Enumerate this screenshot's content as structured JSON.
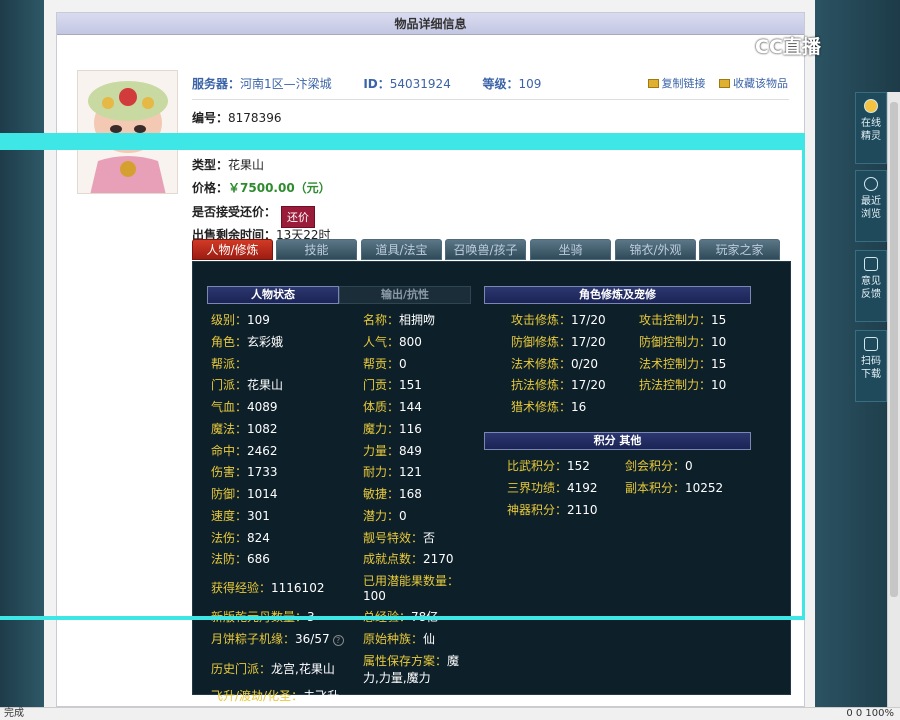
{
  "panel": {
    "title": "物品详细信息"
  },
  "header": {
    "server_label": "服务器：",
    "server": "河南1区—汴梁城",
    "id_label": "ID：",
    "id": "54031924",
    "level_label": "等级：",
    "level": "109",
    "copy_link": "复制链接",
    "favorite": "收藏该物品"
  },
  "item": {
    "code_label": "编号：",
    "code": "8178396",
    "type_label": "类型：",
    "type": "花果山",
    "price_label": "价格：",
    "price": "￥7500.00（元）",
    "counter_label": "是否接受还价：",
    "counter_btn": "还价",
    "time_label": "出售剩余时间：",
    "time": "13天22时"
  },
  "tabs": [
    "人物/修炼",
    "技能",
    "道具/法宝",
    "召唤兽/孩子",
    "坐骑",
    "锦衣/外观",
    "玩家之家"
  ],
  "sections": {
    "char_status": "人物状态",
    "output": "输出/抗性",
    "cultivation": "角色修炼及宠修",
    "points": "积分 其他"
  },
  "stats_left": [
    {
      "k": "级别：",
      "v": "109"
    },
    {
      "k": "角色：",
      "v": "玄彩娥"
    },
    {
      "k": "帮派：",
      "v": ""
    },
    {
      "k": "门派：",
      "v": "花果山"
    },
    {
      "k": "气血：",
      "v": "4089"
    },
    {
      "k": "魔法：",
      "v": "1082"
    },
    {
      "k": "命中：",
      "v": "2462"
    },
    {
      "k": "伤害：",
      "v": "1733"
    },
    {
      "k": "防御：",
      "v": "1014"
    },
    {
      "k": "速度：",
      "v": "301"
    },
    {
      "k": "法伤：",
      "v": "824"
    },
    {
      "k": "法防：",
      "v": "686"
    },
    {
      "k": "获得经验：",
      "v": "1116102"
    },
    {
      "k": "新版乾元丹数量：",
      "v": "3"
    },
    {
      "k": "月饼粽子机缘：",
      "v": "36/57"
    },
    {
      "k": "历史门派：",
      "v": "龙宫,花果山"
    },
    {
      "k": "飞升/渡劫/化圣：",
      "v": "未飞升"
    }
  ],
  "stats_mid": [
    {
      "k": "名称：",
      "v": "相拥吻"
    },
    {
      "k": "人气：",
      "v": "800"
    },
    {
      "k": "帮贡：",
      "v": "0"
    },
    {
      "k": "门贡：",
      "v": "151"
    },
    {
      "k": "体质：",
      "v": "144"
    },
    {
      "k": "魔力：",
      "v": "116"
    },
    {
      "k": "力量：",
      "v": "849"
    },
    {
      "k": "耐力：",
      "v": "121"
    },
    {
      "k": "敏捷：",
      "v": "168"
    },
    {
      "k": "潜力：",
      "v": "0"
    },
    {
      "k": "靓号特效：",
      "v": "否"
    },
    {
      "k": "成就点数：",
      "v": "2170"
    },
    {
      "k": "已用潜能果数量：",
      "v": "100"
    },
    {
      "k": "总经验：",
      "v": "78亿"
    },
    {
      "k": "原始种族：",
      "v": "仙"
    },
    {
      "k": "属性保存方案：",
      "v": "魔力,力量,魔力"
    }
  ],
  "cult_left": [
    {
      "k": "攻击修炼：",
      "v": "17/20"
    },
    {
      "k": "防御修炼：",
      "v": "17/20"
    },
    {
      "k": "法术修炼：",
      "v": "0/20"
    },
    {
      "k": "抗法修炼：",
      "v": "17/20"
    },
    {
      "k": "猎术修炼：",
      "v": "16"
    }
  ],
  "cult_right": [
    {
      "k": "攻击控制力：",
      "v": "15"
    },
    {
      "k": "防御控制力：",
      "v": "10"
    },
    {
      "k": "法术控制力：",
      "v": "15"
    },
    {
      "k": "抗法控制力：",
      "v": "10"
    }
  ],
  "points": [
    {
      "k": "比武积分：",
      "v": "152"
    },
    {
      "k": "剑会积分：",
      "v": "0"
    },
    {
      "k": "三界功绩：",
      "v": "4192"
    },
    {
      "k": "副本积分：",
      "v": "10252"
    },
    {
      "k": "神器积分：",
      "v": "2110"
    }
  ],
  "float": [
    {
      "label": "在线\n精灵",
      "icon": "elf-icon"
    },
    {
      "label": "最近\n浏览",
      "icon": "clock-icon"
    },
    {
      "label": "意见\n反馈",
      "icon": "edit-icon"
    },
    {
      "label": "扫码\n下载",
      "icon": "qr-icon"
    }
  ],
  "logo": "CC直播",
  "status": {
    "left": "完成",
    "right": "0   0   100%"
  }
}
